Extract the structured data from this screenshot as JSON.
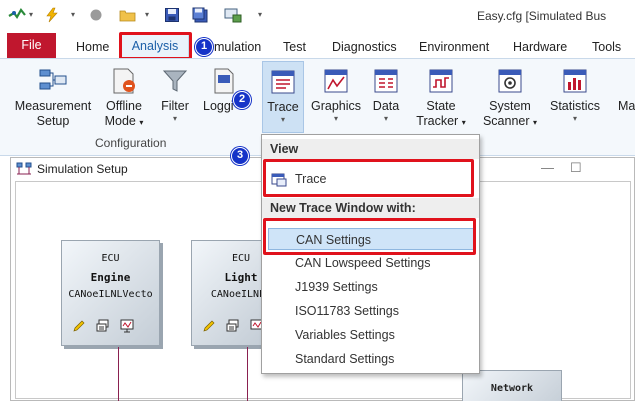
{
  "window": {
    "title": "Easy.cfg [Simulated Bus"
  },
  "quick_access": {
    "icons": [
      "app-logo-icon",
      "lightning-icon",
      "stop-icon",
      "open-folder-icon",
      "save-icon",
      "save-all-icon",
      "monitor-icon"
    ],
    "customize_caret": "▾"
  },
  "ribbon_tabs": [
    "File",
    "Home",
    "Analysis",
    "mulation",
    "Test",
    "Diagnostics",
    "Environment",
    "Hardware",
    "Tools"
  ],
  "ribbon": {
    "buttons": [
      {
        "label1": "Measurement",
        "label2": "Setup"
      },
      {
        "label1": "Offline",
        "label2": "Mode"
      },
      {
        "label1": "Filter",
        "label2": ""
      },
      {
        "label1": "Loggi",
        "label2": ""
      },
      {
        "label1": "Trace",
        "label2": ""
      },
      {
        "label1": "Graphics",
        "label2": ""
      },
      {
        "label1": "Data",
        "label2": ""
      },
      {
        "label1": "State",
        "label2": "Tracker"
      },
      {
        "label1": "System",
        "label2": "Scanner"
      },
      {
        "label1": "Statistics",
        "label2": ""
      },
      {
        "label1": "Ma",
        "label2": ""
      }
    ],
    "group_label": "Configuration"
  },
  "badges": [
    "1",
    "2",
    "3"
  ],
  "simulation_window": {
    "title": "Simulation Setup",
    "controls": {
      "minimize": "—",
      "maximize": "☐"
    },
    "ecus": [
      {
        "line1": "ECU",
        "line2": "Engine",
        "line3": "CANoeILNLVecto"
      },
      {
        "line1": "ECU",
        "line2": "Light",
        "line3": "CANoeILNLV"
      }
    ],
    "network_label": "Network"
  },
  "menu": {
    "view_header": "View",
    "view_items": [
      {
        "label": "Trace",
        "icon": "trace-window-icon"
      }
    ],
    "new_header": "New Trace Window with:",
    "new_items": [
      "CAN Settings",
      "CAN Lowspeed Settings",
      "J1939 Settings",
      "ISO11783 Settings",
      "Variables Settings",
      "Standard Settings"
    ]
  },
  "colors": {
    "file_tab": "#c0172e",
    "highlight": "#e0121c",
    "badge": "#1533c8",
    "selected_item": "#cfe4f8"
  }
}
